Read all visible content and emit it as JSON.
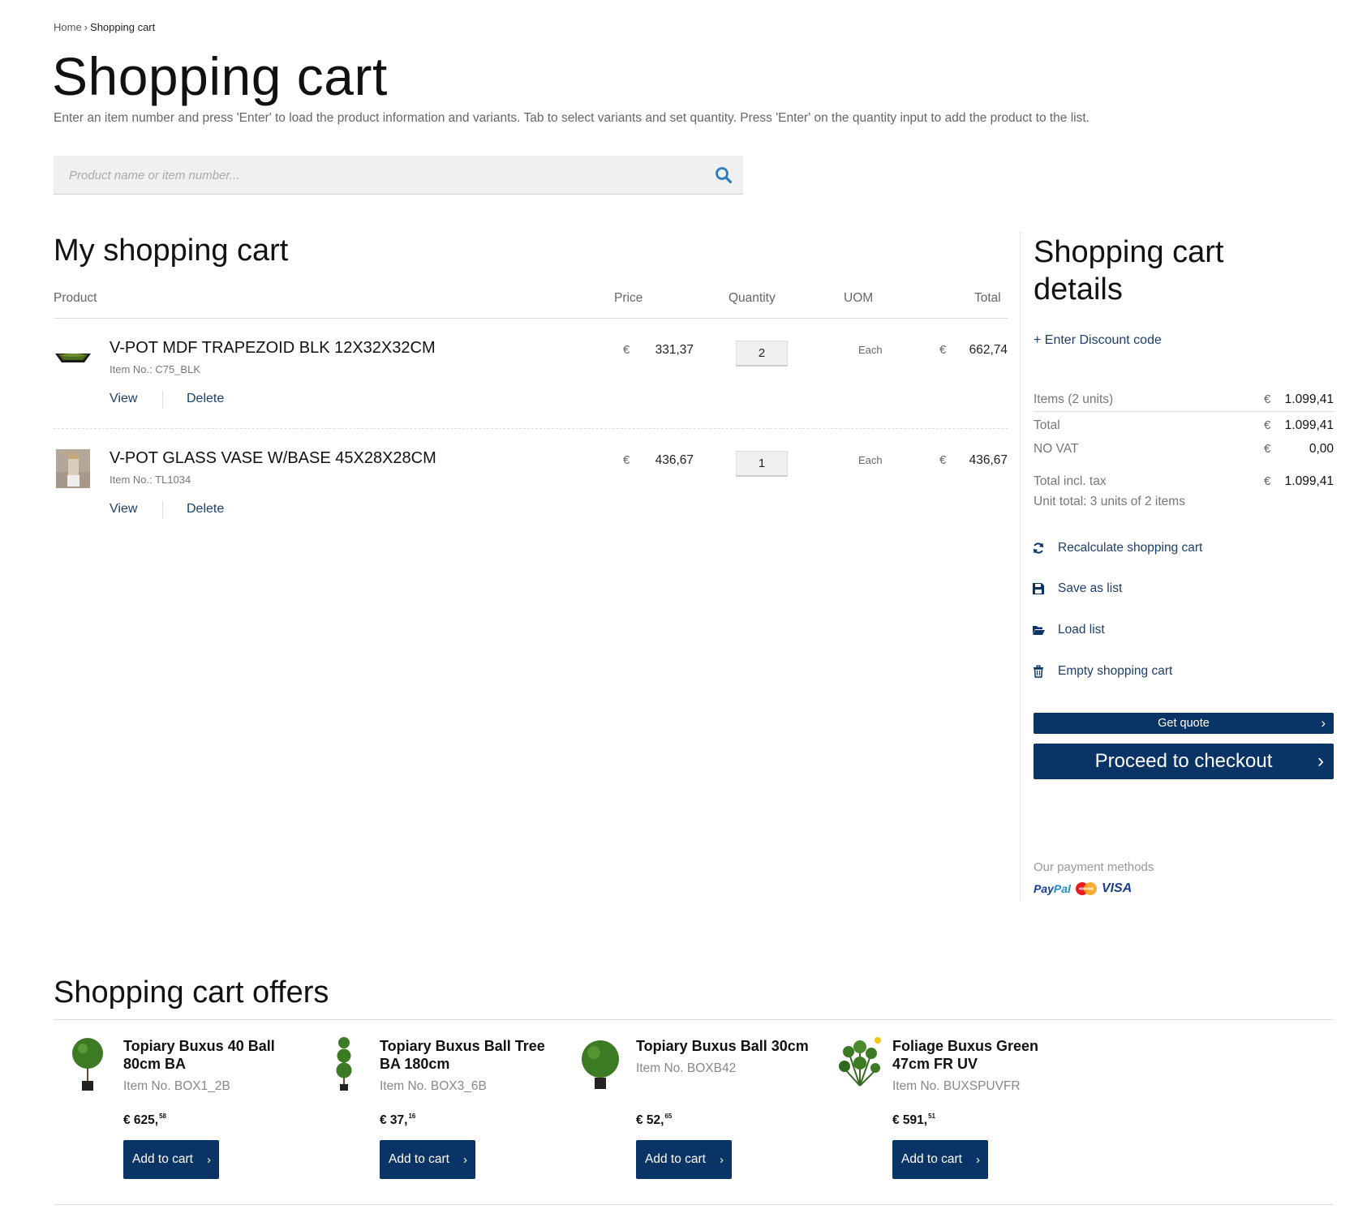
{
  "breadcrumb": {
    "home": "Home",
    "separator": "›",
    "current": "Shopping cart"
  },
  "page": {
    "title": "Shopping cart",
    "intro": "Enter an item number and press 'Enter' to load the product information and variants. Tab to select variants and set quantity. Press 'Enter' on the quantity input to add the product to the list."
  },
  "search": {
    "placeholder": "Product name or item number...",
    "icon": "search-icon"
  },
  "cart": {
    "title": "My shopping cart",
    "columns": {
      "product": "Product",
      "price": "Price",
      "quantity": "Quantity",
      "uom": "UOM",
      "total": "Total"
    },
    "currency": "€",
    "items": [
      {
        "name": "V-POT MDF TRAPEZOID BLK 12X32X32CM",
        "item_no": "Item No.: C75_BLK",
        "price": "331,37",
        "quantity": "2",
        "uom": "Each",
        "total": "662,74",
        "view": "View",
        "delete": "Delete"
      },
      {
        "name": "V-POT GLASS VASE W/BASE 45X28X28CM",
        "item_no": "Item No.: TL1034",
        "price": "436,67",
        "quantity": "1",
        "uom": "Each",
        "total": "436,67",
        "view": "View",
        "delete": "Delete"
      }
    ]
  },
  "details": {
    "title": "Shopping cart details",
    "discount": "+ Enter Discount code",
    "currency": "€",
    "summary": [
      {
        "label": "Items (2 units)",
        "value": "1.099,41"
      },
      {
        "label": "Total",
        "value": "1.099,41"
      },
      {
        "label": "NO VAT",
        "value": "0,00"
      },
      {
        "label": "Total incl. tax",
        "value": "1.099,41"
      }
    ],
    "unit_total": "Unit total: 3 units of 2 items",
    "actions": {
      "recalculate": "Recalculate shopping cart",
      "save_list": "Save as list",
      "load_list": "Load list",
      "empty_cart": "Empty shopping cart"
    },
    "get_quote": "Get quote",
    "checkout": "Proceed to checkout",
    "chevron": "›",
    "payment_label": "Our payment methods",
    "payment_methods": {
      "paypal_a": "Pay",
      "paypal_b": "Pal",
      "visa": "VISA"
    }
  },
  "offers": {
    "title": "Shopping cart offers",
    "add_label": "Add to cart",
    "items": [
      {
        "name": "Topiary Buxus 40 Ball 80cm BA",
        "item_no": "Item No. BOX1_2B",
        "price_main": "€ 625,",
        "price_cents": "58"
      },
      {
        "name": "Topiary Buxus Ball Tree BA 180cm",
        "item_no": "Item No. BOX3_6B",
        "price_main": "€ 37,",
        "price_cents": "16"
      },
      {
        "name": "Topiary Buxus Ball 30cm",
        "item_no": "Item No. BOXB42",
        "price_main": "€ 52,",
        "price_cents": "65"
      },
      {
        "name": "Foliage Buxus Green 47cm FR UV",
        "item_no": "Item No. BUXSPUVFR",
        "price_main": "€ 591,",
        "price_cents": "51"
      }
    ]
  },
  "colors": {
    "primary": "#0b3466",
    "link": "#1d3f6b",
    "icon_blue": "#2a7bc0",
    "search_bg": "#f0f0f0"
  }
}
